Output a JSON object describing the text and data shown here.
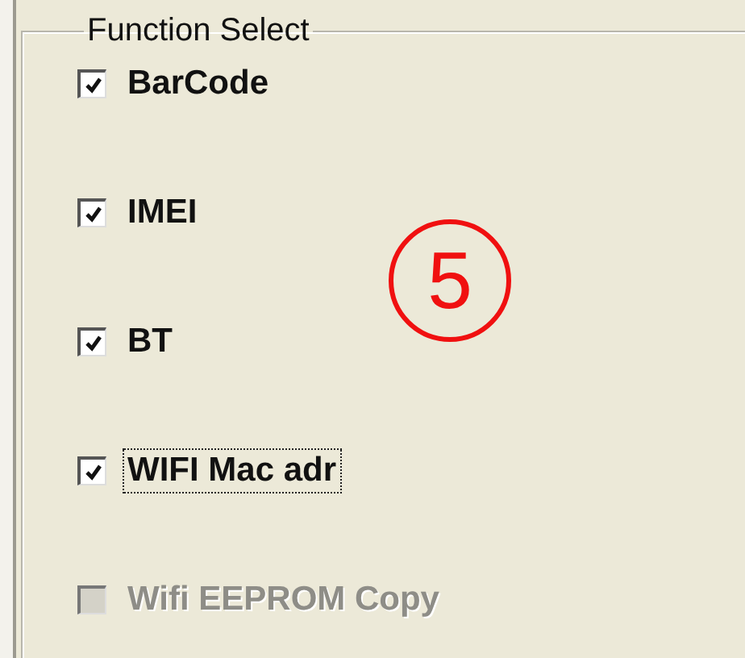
{
  "group": {
    "title": "Function Select"
  },
  "annotation": {
    "text": "5"
  },
  "options": [
    {
      "label": "BarCode",
      "checked": true,
      "disabled": false,
      "focused": false
    },
    {
      "label": "IMEI",
      "checked": true,
      "disabled": false,
      "focused": false
    },
    {
      "label": "BT",
      "checked": true,
      "disabled": false,
      "focused": false
    },
    {
      "label": "WIFI Mac adr",
      "checked": true,
      "disabled": false,
      "focused": true
    },
    {
      "label": "Wifi EEPROM Copy",
      "checked": false,
      "disabled": true,
      "focused": false
    }
  ]
}
